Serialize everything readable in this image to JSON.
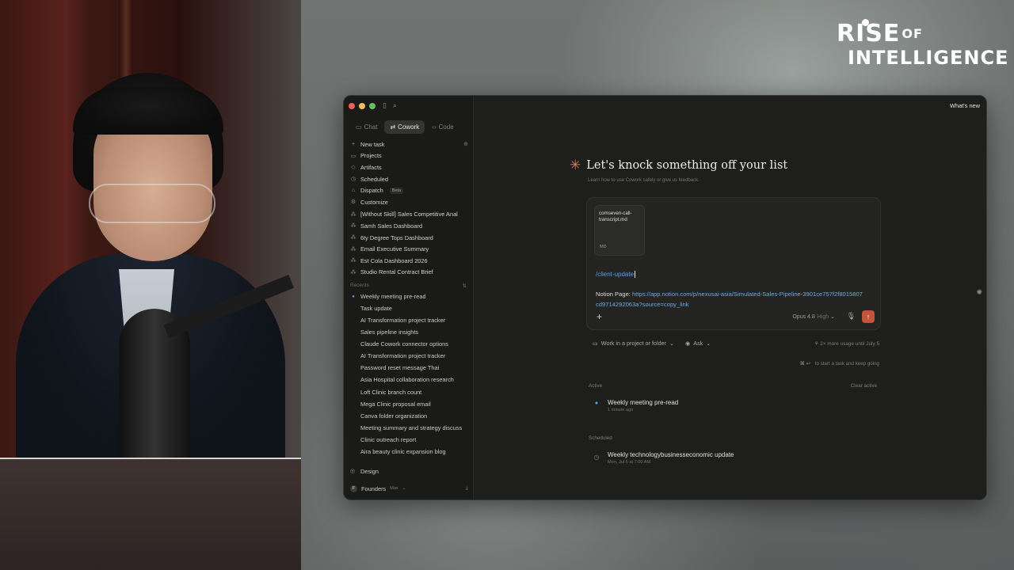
{
  "logo": {
    "line1": "RISE",
    "of": "OF",
    "line2": "INTELLIGENCE"
  },
  "window": {
    "whats_new": "What's new",
    "modes": [
      {
        "label": "Chat",
        "icon": "chat-icon"
      },
      {
        "label": "Cowork",
        "icon": "cowork-icon",
        "active": true
      },
      {
        "label": "Code",
        "icon": "code-icon"
      }
    ],
    "nav": [
      {
        "label": "New task",
        "icon": "plus-icon"
      },
      {
        "label": "Projects",
        "icon": "folder-icon"
      },
      {
        "label": "Artifacts",
        "icon": "artifact-icon"
      },
      {
        "label": "Scheduled",
        "icon": "clock-icon"
      },
      {
        "label": "Dispatch",
        "icon": "dispatch-icon",
        "badge": "Beta"
      },
      {
        "label": "Customize",
        "icon": "customize-icon"
      }
    ],
    "pinned": [
      "[Without Skill] Sales Competitive Anal",
      "Samh Sales Dashboard",
      "6ty Degree Tops Dashboard",
      "Email Executive Summary",
      "Est Cola Dashboard 2026",
      "Studio Rental Contract Brief"
    ],
    "recents_label": "Recents",
    "recents": [
      "Weekly meeting pre-read",
      "Task update",
      "AI Transformation project tracker",
      "Sales pipeline insights",
      "Claude Cowork connector options",
      "AI Transformation project tracker",
      "Password reset message Thai",
      "Asia Hospital collaboration research",
      "Loft Clinic branch count",
      "Mega Clinic proposal email",
      "Canva folder organization",
      "Meeting summary and strategy discuss",
      "Clinic outreach report",
      "Aira beauty clinic expansion blog"
    ],
    "footer": {
      "design": "Design",
      "org_initial": "F",
      "org": "Founders",
      "plan": "Max"
    }
  },
  "main": {
    "title": "Let's knock something off your list",
    "subtitle": "Learn how to use Cowork safely or give us feedback.",
    "attachment": {
      "name": "comseven-call-transcript.md",
      "type": "MD"
    },
    "slash_command": "/client-update",
    "notion_label": "Notion Page:",
    "notion_url": "https://app.notion.com/p/nexusai-asia/Simulated-Sales-Pipeline-3901ce757f2f8015807cd9714292063a?source=copy_link",
    "model": "Opus 4.8",
    "effort": "High",
    "project_picker": "Work in a project or folder",
    "mode_picker": "Ask",
    "usage": "2× more usage until July 5",
    "hint_keys": "⌘ ↩",
    "hint": "to start a task and keep going",
    "active_label": "Active",
    "clear_active": "Clear active",
    "active_tasks": [
      {
        "title": "Weekly meeting pre-read",
        "time": "1 minute ago"
      }
    ],
    "scheduled_label": "Scheduled",
    "scheduled_tasks": [
      {
        "title": "Weekly technologybusinesseconomic update",
        "time": "Mon, Jul 6 at 7:00 AM"
      }
    ]
  },
  "colors": {
    "accent": "#d97757",
    "send": "#c4553a",
    "link": "#6aa7e8",
    "window_bg": "#1e1e1d"
  }
}
